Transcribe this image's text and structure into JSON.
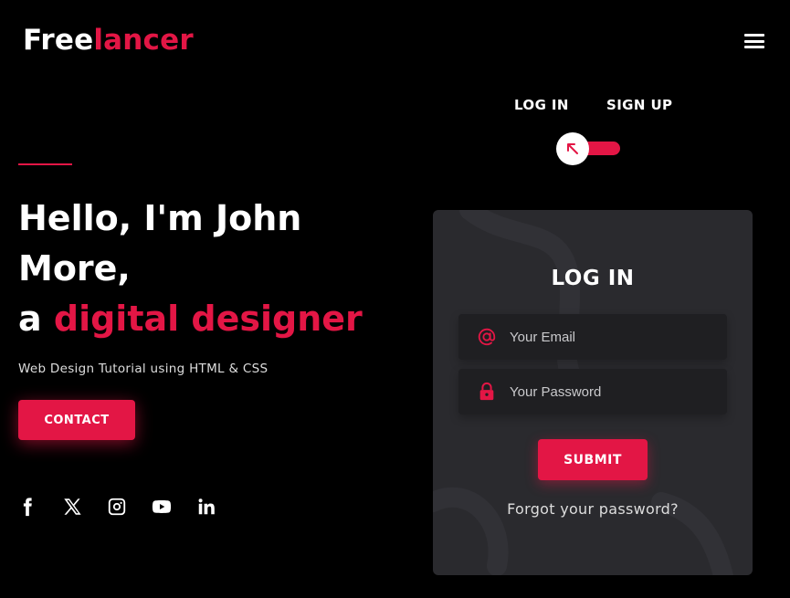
{
  "brand": {
    "part1": "Free",
    "part2": "lancer",
    "accent_color": "#e31645"
  },
  "header": {
    "menu_icon": "hamburger-icon"
  },
  "hero": {
    "title_line1": "Hello, I'm John",
    "title_line2": "More,",
    "title_prefix": "a ",
    "title_accent": "digital designer",
    "subtitle": "Web Design Tutorial using HTML & CSS",
    "contact_label": "CONTACT"
  },
  "socials": [
    {
      "icon": "facebook-icon"
    },
    {
      "icon": "x-icon"
    },
    {
      "icon": "instagram-icon"
    },
    {
      "icon": "youtube-icon"
    },
    {
      "icon": "linkedin-icon"
    }
  ],
  "auth_tabs": {
    "login": "LOG IN",
    "signup": "SIGN UP",
    "toggle_icon": "arrow-up-left-icon"
  },
  "login_card": {
    "title": "LOG IN",
    "email_placeholder": "Your Email",
    "password_placeholder": "Your Password",
    "submit_label": "SUBMIT",
    "forgot_label": "Forgot your password?"
  }
}
